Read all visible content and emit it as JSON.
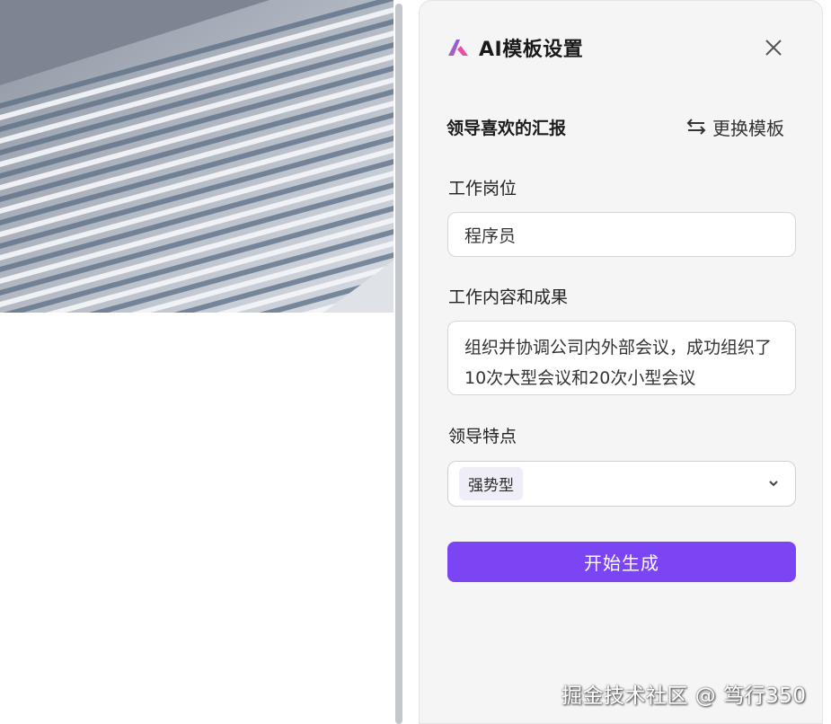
{
  "panel": {
    "title": "AI模板设置",
    "template_name": "领导喜欢的汇报",
    "swap_label": "更换模板",
    "generate_label": "开始生成"
  },
  "fields": {
    "position": {
      "label": "工作岗位",
      "value": "程序员"
    },
    "content": {
      "label": "工作内容和成果",
      "value": "组织并协调公司内外部会议，成功组织了10次大型会议和20次小型会议"
    },
    "leader": {
      "label": "领导特点",
      "selected": "强势型"
    }
  },
  "watermark": "掘金技术社区 @ 笃行350",
  "colors": {
    "accent": "#7c45f3",
    "panel_bg": "#f5f5f5",
    "logo_gradient": [
      "#4f6cf5",
      "#e651a8"
    ]
  },
  "icons": {
    "logo": "ai-logo-icon",
    "close": "close-icon",
    "swap": "swap-arrows-icon",
    "dropdown": "chevron-down-icon"
  }
}
